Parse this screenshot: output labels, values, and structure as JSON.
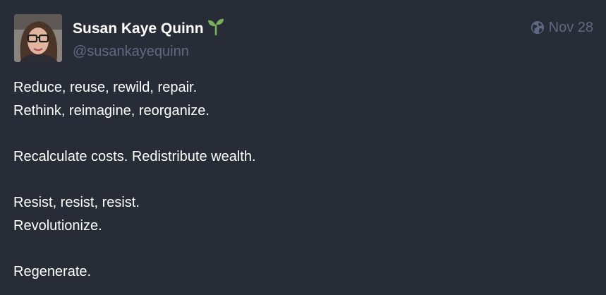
{
  "author": {
    "display_name": "Susan Kaye Quinn",
    "handle": "@susankayequinn",
    "name_emoji": "seedling-icon"
  },
  "meta": {
    "visibility_icon": "globe-icon",
    "date": "Nov 28"
  },
  "content": {
    "paragraphs": [
      {
        "lines": [
          "Reduce, reuse, rewild, repair.",
          "Rethink, reimagine, reorganize."
        ]
      },
      {
        "lines": [
          "Recalculate costs. Redistribute wealth."
        ]
      },
      {
        "lines": [
          "Resist, resist, resist.",
          "Revolutionize."
        ]
      },
      {
        "lines": [
          "Regenerate."
        ]
      }
    ]
  },
  "colors": {
    "background": "#282c37",
    "text": "#ffffff",
    "muted": "#606984",
    "seedling": "#78b159"
  }
}
